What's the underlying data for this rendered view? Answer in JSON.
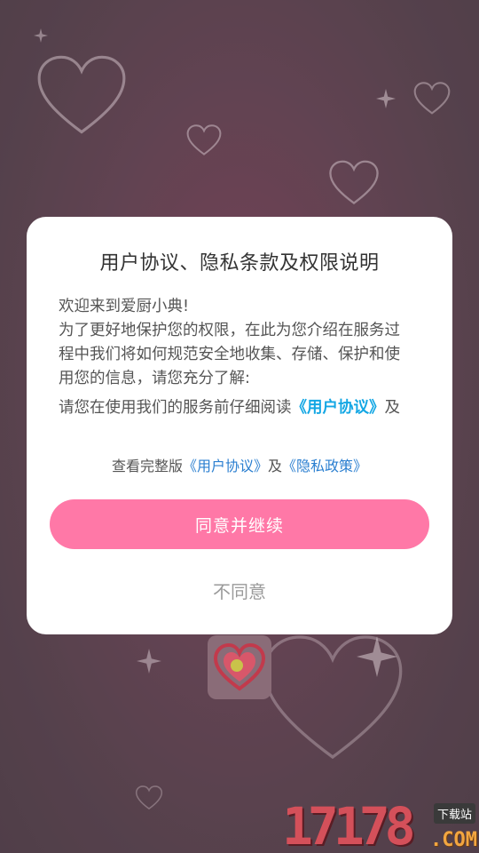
{
  "dialog": {
    "title": "用户协议、隐私条款及权限说明",
    "welcome": "欢迎来到爱厨小典!",
    "intro": "为了更好地保护您的权限，在此为您介绍在服务过程中我们将如何规范安全地收集、存储、保护和使用您的信息，请您充分了解:",
    "read_prefix": "请您在使用我们的服务前仔细阅读",
    "read_link_user_agreement": "《用户协议》",
    "read_suffix": "及",
    "full_version_prefix": "查看完整版",
    "full_version_user_agreement": "《用户协议》",
    "full_version_and": "及",
    "full_version_privacy_policy": "《隐私政策》",
    "agree_button": "同意并继续",
    "disagree_button": "不同意"
  },
  "watermark": {
    "number": "17178",
    "tag": "下载站",
    "domain": ".COM"
  },
  "colors": {
    "accent_pink": "#ff78a7",
    "link_cyan": "#14a7e4",
    "link_blue": "#2b7fd0"
  }
}
